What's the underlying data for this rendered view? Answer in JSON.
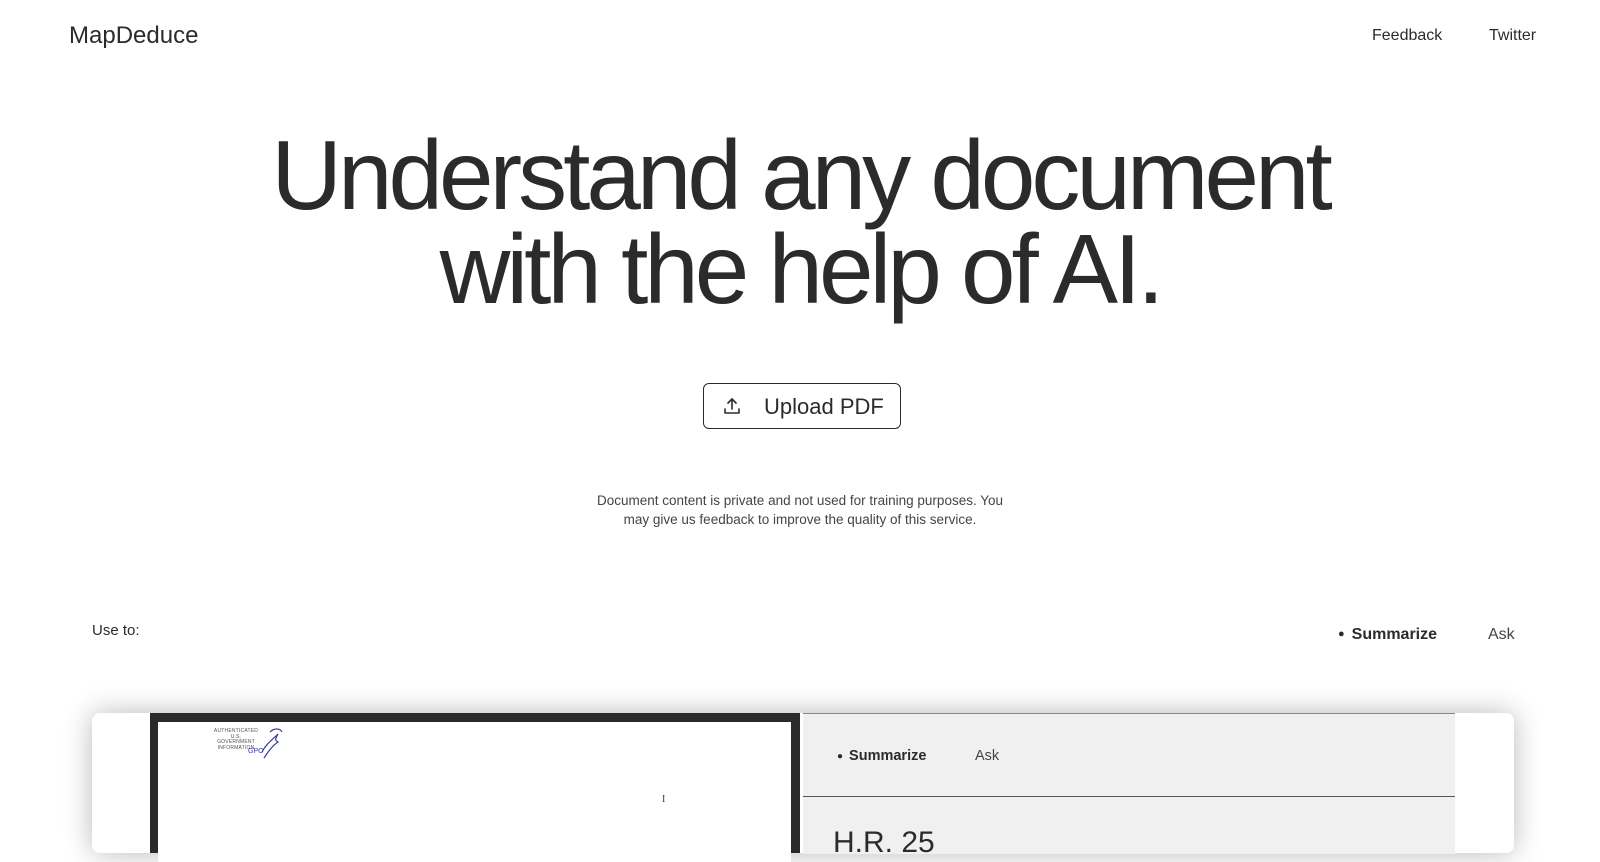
{
  "header": {
    "logo": "MapDeduce",
    "nav": {
      "feedback": "Feedback",
      "twitter": "Twitter"
    }
  },
  "hero": {
    "line1": "Understand any document",
    "line2": "with the help of AI."
  },
  "upload": {
    "label": "Upload PDF",
    "icon": "upload-icon"
  },
  "privacy": {
    "line1": "Document content is private and not used for training purposes. You",
    "line2": "may give us feedback to improve the quality of this service."
  },
  "modes": {
    "label": "Use to:",
    "tabs": [
      {
        "label": "Summarize",
        "active": true
      },
      {
        "label": "Ask",
        "active": false
      }
    ]
  },
  "preview": {
    "document": {
      "seal_text": "AUTHENTICATED U.S. GOVERNMENT INFORMATION",
      "seal_label": "GPO",
      "mark": "I"
    },
    "panel": {
      "tabs": [
        {
          "label": "Summarize",
          "active": true
        },
        {
          "label": "Ask",
          "active": false
        }
      ],
      "heading": "H.R. 25"
    }
  },
  "colors": {
    "text": "#2b2b2b",
    "panel_bg": "#f0f0f0",
    "frame": "#2a2a2a",
    "seal": "#3a3aa0"
  }
}
